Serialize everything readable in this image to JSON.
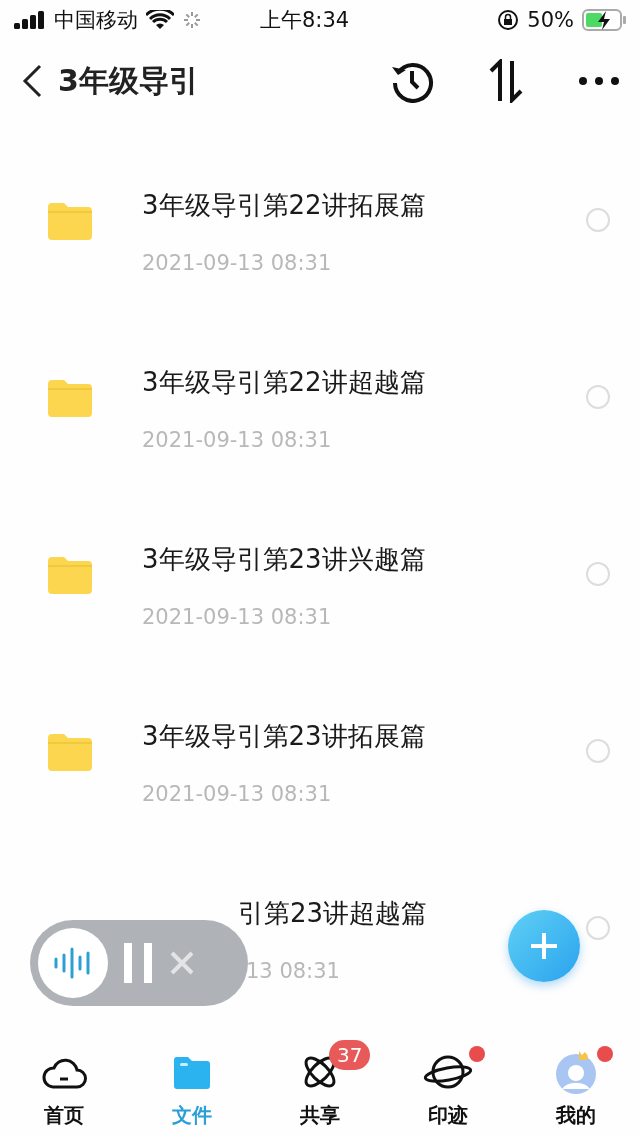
{
  "status_bar": {
    "carrier": "中国移动",
    "time": "上午8:34",
    "battery": "50%"
  },
  "header": {
    "title": "3年级导引"
  },
  "files": [
    {
      "kind": "folder",
      "name": "3年级导引第22讲拓展篇",
      "date": "2021-09-13 08:31",
      "selected": false
    },
    {
      "kind": "folder",
      "name": "3年级导引第22讲超越篇",
      "date": "2021-09-13 08:31",
      "selected": false
    },
    {
      "kind": "folder",
      "name": "3年级导引第23讲兴趣篇",
      "date": "2021-09-13 08:31",
      "selected": false
    },
    {
      "kind": "folder",
      "name": "3年级导引第23讲拓展篇",
      "date": "2021-09-13 08:31",
      "selected": false
    },
    {
      "kind": "covered",
      "name": "引第23讲超越篇",
      "date": "13 08:31",
      "selected": false
    }
  ],
  "tabs": [
    {
      "kind": "home",
      "label": "首页",
      "selected": false
    },
    {
      "kind": "files",
      "label": "文件",
      "selected": true
    },
    {
      "kind": "share",
      "label": "共享",
      "selected": false,
      "badge": "37"
    },
    {
      "kind": "trace",
      "label": "印迹",
      "selected": false,
      "dot": true
    },
    {
      "kind": "me",
      "label": "我的",
      "selected": false,
      "dot": true
    }
  ]
}
